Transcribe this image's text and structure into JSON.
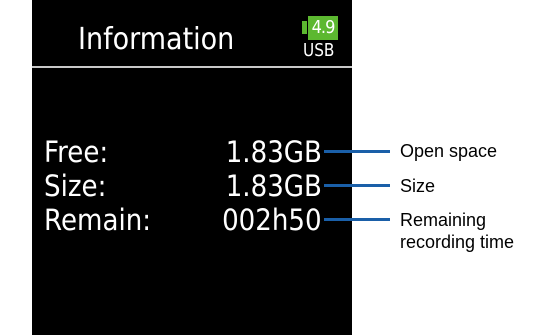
{
  "screen": {
    "title": "Information",
    "battery_level": "4.9",
    "power_source": "USB",
    "battery_color": "#5cb830"
  },
  "info_rows": [
    {
      "label": "Free:",
      "value": "1.83GB"
    },
    {
      "label": "Size:",
      "value": "1.83GB"
    },
    {
      "label": "Remain:",
      "value": "002h50"
    }
  ],
  "callouts": [
    {
      "text": "Open space"
    },
    {
      "text": "Size"
    },
    {
      "text": "Remaining recording time"
    }
  ],
  "callout_color": "#1a5fa8"
}
